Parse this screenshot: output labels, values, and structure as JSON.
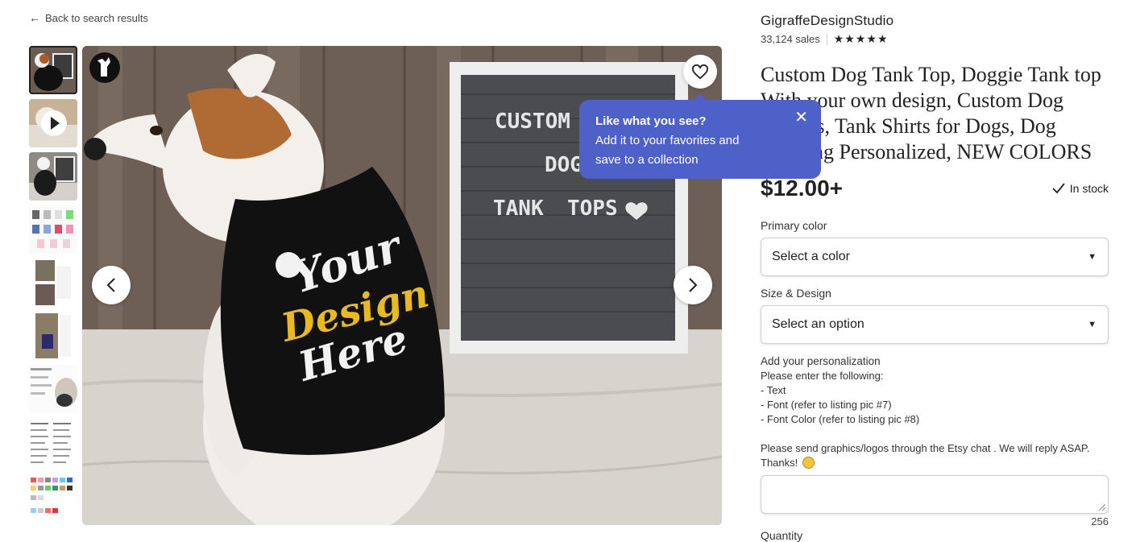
{
  "nav": {
    "back_label": "Back to search results"
  },
  "gallery": {
    "thumbnail_count": 9,
    "selected_index": 1,
    "main_image_text": {
      "letter_board": [
        "CUSTOM",
        "DOG",
        "TANK",
        "TOPS"
      ],
      "shirt_print": [
        "Your",
        "Design",
        "Here"
      ]
    }
  },
  "tooltip": {
    "title": "Like what you see?",
    "line1": "Add it to your favorites and",
    "line2": "save to a collection"
  },
  "shop": {
    "name": "GigraffeDesignStudio",
    "sales": "33,124 sales",
    "rating_stars": 5
  },
  "listing": {
    "title": "Custom Dog Tank Top, Doggie Tank top With your own design, Custom Dog Clothes, Tank Shirts for Dogs, Dog Clothing Personalized, NEW COLORS",
    "price": "$12.00+",
    "stock": "In stock"
  },
  "options": {
    "primary_color_label": "Primary color",
    "primary_color_value": "Select a color",
    "size_label": "Size & Design",
    "size_value": "Select an option"
  },
  "personalization": {
    "heading": "Add your personalization",
    "intro": "Please enter the following:",
    "items": [
      "- Text",
      "- Font (refer to listing pic #7)",
      "- Font Color (refer to listing pic #8)"
    ],
    "note": "Please send graphics/logos through the Etsy chat . We will reply ASAP. Thanks!",
    "char_count": "256"
  },
  "quantity_label": "Quantity",
  "colors": {
    "tooltip_bg": "#4d61c9",
    "shirt": "#111111",
    "print_yellow": "#e9b920"
  }
}
